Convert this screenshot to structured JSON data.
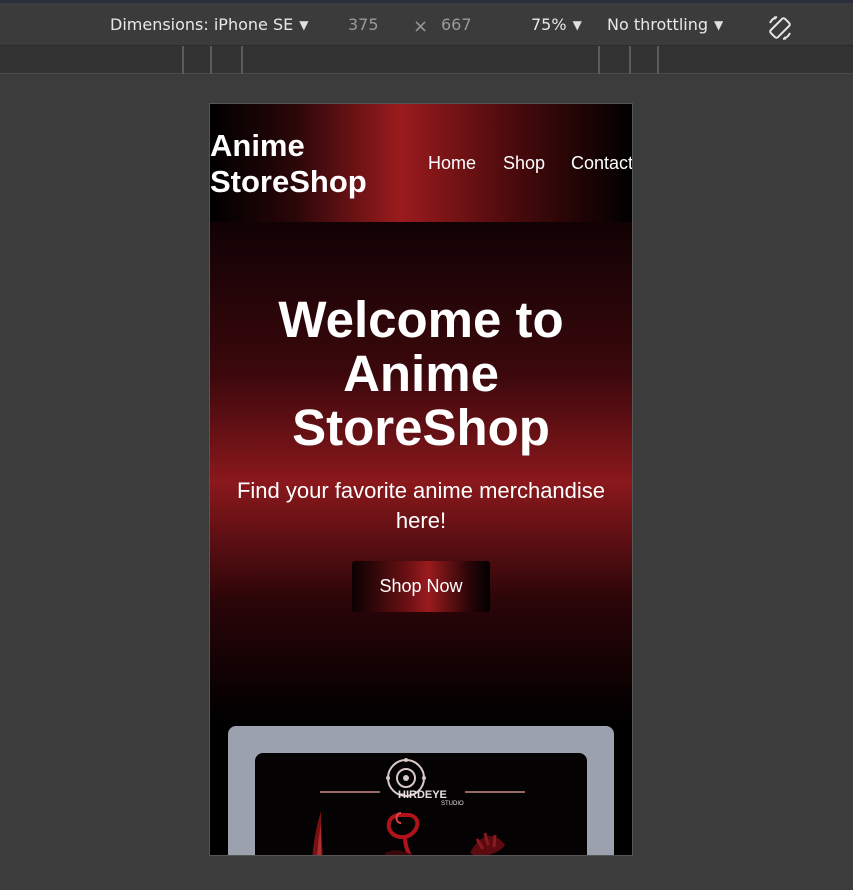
{
  "devtools": {
    "dimensions_label": "Dimensions: iPhone SE",
    "width": "375",
    "times": "×",
    "height": "667",
    "zoom": "75%",
    "throttling": "No throttling",
    "rotate_icon": "rotate-icon"
  },
  "site": {
    "brand": "Anime StoreShop",
    "nav": [
      "Home",
      "Shop",
      "Contact"
    ],
    "hero": {
      "title": "Welcome to Anime StoreShop",
      "subtitle": "Find your favorite anime merchandise here!",
      "cta": "Shop Now"
    },
    "product": {
      "logo_text": "THIRDEYE",
      "logo_sub": "STUDIO"
    }
  },
  "colors": {
    "accent_red": "#9b1b1e",
    "card_gray": "#9ba1ad",
    "devtools_bg": "#3c3c3c"
  }
}
